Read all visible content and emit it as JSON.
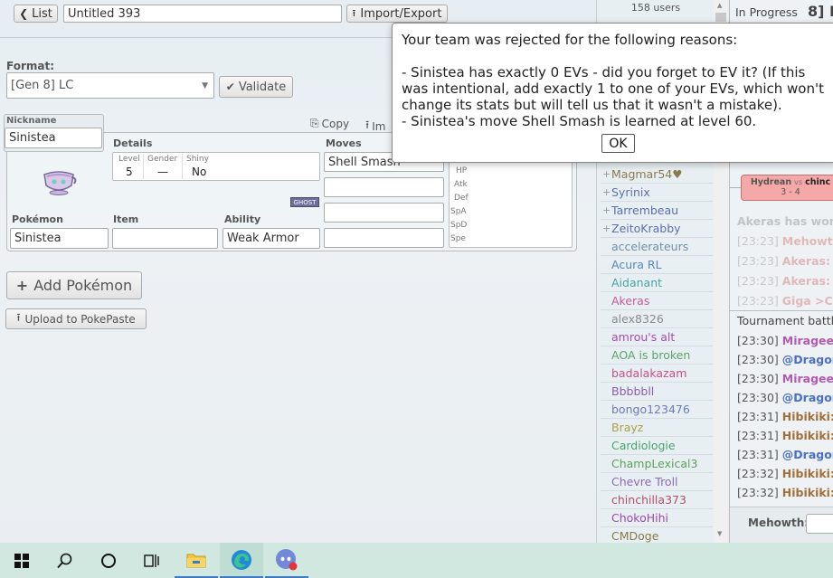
{
  "toolbar": {
    "list_label": "List",
    "team_name": "Untitled 393",
    "import_export_label": "Import/Export"
  },
  "format": {
    "label": "Format:",
    "value": "[Gen 8] LC",
    "validate_label": "Validate"
  },
  "pokemon": {
    "nickname_label": "Nickname",
    "nickname": "Sinistea",
    "copy_label": "Copy",
    "import_label": "Im",
    "details_label": "Details",
    "level_label": "Level",
    "level": "5",
    "gender_label": "Gender",
    "gender": "—",
    "shiny_label": "Shiny",
    "shiny": "No",
    "type_badge": "GHOST",
    "moves_label": "Moves",
    "moves": [
      "Shell Smash",
      "",
      "",
      ""
    ],
    "stat_labels": [
      "HP",
      "Atk",
      "Def",
      "SpA",
      "SpD",
      "Spe"
    ],
    "species_label": "Pokémon",
    "species": "Sinistea",
    "item_label": "Item",
    "item": "",
    "ability_label": "Ability",
    "ability": "Weak Armor"
  },
  "actions": {
    "add_pokemon": "Add Pokémon",
    "upload": "Upload to PokePaste"
  },
  "userlist": {
    "count": "158 users",
    "users": [
      {
        "name": "Magmar54",
        "color": "#8a7a50",
        "plus": true,
        "heart": true
      },
      {
        "name": "Syrinix",
        "color": "#5a6fb0",
        "plus": true
      },
      {
        "name": "Tarrembeau",
        "color": "#5a6fb0",
        "plus": true
      },
      {
        "name": "ZeitoKrabby",
        "color": "#5a6fb0",
        "plus": true
      },
      {
        "name": "accelerateurs",
        "color": "#6f8fa8"
      },
      {
        "name": "Acura RL",
        "color": "#5a86b8"
      },
      {
        "name": "Aidanant",
        "color": "#4aa3a3"
      },
      {
        "name": "Akeras",
        "color": "#c45a9a"
      },
      {
        "name": "alex8326",
        "color": "#8a8a8a"
      },
      {
        "name": "amrou's alt",
        "color": "#a64ab0"
      },
      {
        "name": "AOA is broken",
        "color": "#5aa36a"
      },
      {
        "name": "badalakazam",
        "color": "#c4508a"
      },
      {
        "name": "Bbbbbll",
        "color": "#8a5ab8"
      },
      {
        "name": "bongo123476",
        "color": "#6a7ab8"
      },
      {
        "name": "Brayz",
        "color": "#a8a04a"
      },
      {
        "name": "Cardiologie",
        "color": "#4aa36a"
      },
      {
        "name": "ChampLexical3",
        "color": "#5aa35a"
      },
      {
        "name": "Chevre Troll",
        "color": "#8a6ab8"
      },
      {
        "name": "chinchilla373",
        "color": "#b0506a"
      },
      {
        "name": "ChokoHihi",
        "color": "#9a4ab0"
      },
      {
        "name": "CMDoge",
        "color": "#8a7a4a"
      }
    ]
  },
  "room": {
    "status": "In Progress",
    "title_fragment": "8] L"
  },
  "battle_card": {
    "player1": "Hydrean",
    "vs": "vs",
    "player2": "chinc",
    "score": "3 - 4"
  },
  "chat": {
    "faded": [
      {
        "ts": "",
        "text": "Akeras has won t"
      },
      {
        "ts": "[23:23]",
        "text": "Mehowth"
      },
      {
        "ts": "[23:23]",
        "text": "Akeras: A"
      },
      {
        "ts": "[23:23]",
        "text": "Akeras: Ca"
      },
      {
        "ts": "[23:23]",
        "text": "Giga >Ch"
      }
    ],
    "tournament_header": "Tournament battle",
    "messages": [
      {
        "ts": "[23:30]",
        "user": "Mirageeu",
        "color": "#b05ab0"
      },
      {
        "ts": "[23:30]",
        "user": "@Dragon",
        "color": "#4a6fc4"
      },
      {
        "ts": "[23:30]",
        "user": "Mirageeu",
        "color": "#b05ab0"
      },
      {
        "ts": "[23:30]",
        "user": "@Dragon",
        "color": "#4a6fc4"
      },
      {
        "ts": "[23:31]",
        "user": "Hibikiki:",
        "color": "#a0703a"
      },
      {
        "ts": "[23:31]",
        "user": "Hibikiki:",
        "color": "#a0703a"
      },
      {
        "ts": "[23:31]",
        "user": "@Dragon",
        "color": "#4a6fc4"
      },
      {
        "ts": "[23:32]",
        "user": "Hibikiki:",
        "color": "#a0703a"
      },
      {
        "ts": "[23:32]",
        "user": "Hibikiki:",
        "color": "#a0703a"
      }
    ],
    "input_label": "Mehowth:"
  },
  "modal": {
    "lines": [
      "Your team was rejected for the following reasons:",
      "",
      "- Sinistea has exactly 0 EVs - did you forget to EV it? (If this",
      "was intentional, add exactly 1 to one of your EVs, which won't",
      "change its stats but will tell us that it wasn't a mistake).",
      "- Sinistea's move Shell Smash is learned at level 60."
    ],
    "ok_label": "OK"
  },
  "taskbar": {
    "items": [
      "windows-start-icon",
      "search-icon",
      "cortana-icon",
      "task-view-icon",
      "file-explorer-icon",
      "edge-browser-icon",
      "discord-icon"
    ]
  }
}
